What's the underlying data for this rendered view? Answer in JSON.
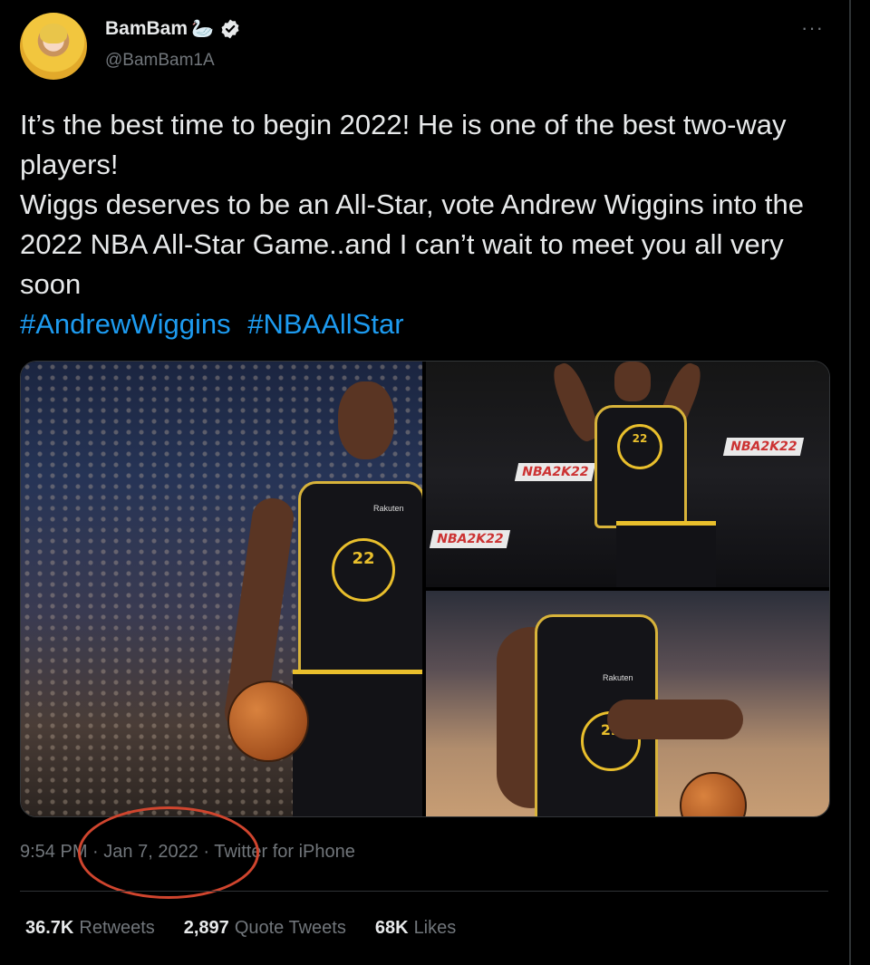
{
  "author": {
    "display_name": "BamBam",
    "name_emoji": "🦢",
    "handle": "@BamBam1A"
  },
  "tweet": {
    "lines": [
      "It’s the best time to begin 2022! He is one of the best two-way players!",
      "Wiggs deserves to be an All-Star, vote Andrew Wiggins into the 2022 NBA All-Star Game..and I can’t wait to meet you all very soon"
    ],
    "hashtags": [
      "#AndrewWiggins",
      "#NBAAllStar"
    ]
  },
  "media": {
    "jersey_number": "22",
    "sponsor": "Rakuten",
    "arena_banner": "NBA2K22"
  },
  "meta": {
    "time": "9:54 PM",
    "date": "Jan 7, 2022",
    "source": "Twitter for iPhone",
    "separator": "·"
  },
  "stats": {
    "retweets_value": "36.7K",
    "retweets_label": "Retweets",
    "quotes_value": "2,897",
    "quotes_label": "Quote Tweets",
    "likes_value": "68K",
    "likes_label": "Likes"
  },
  "colors": {
    "background": "#000000",
    "text": "#e7e9ea",
    "secondary": "#71767b",
    "link": "#1d9bf0",
    "annotation": "#d0452e"
  },
  "icons": [
    "verified-badge-icon",
    "more-options-icon",
    "swan-emoji"
  ]
}
